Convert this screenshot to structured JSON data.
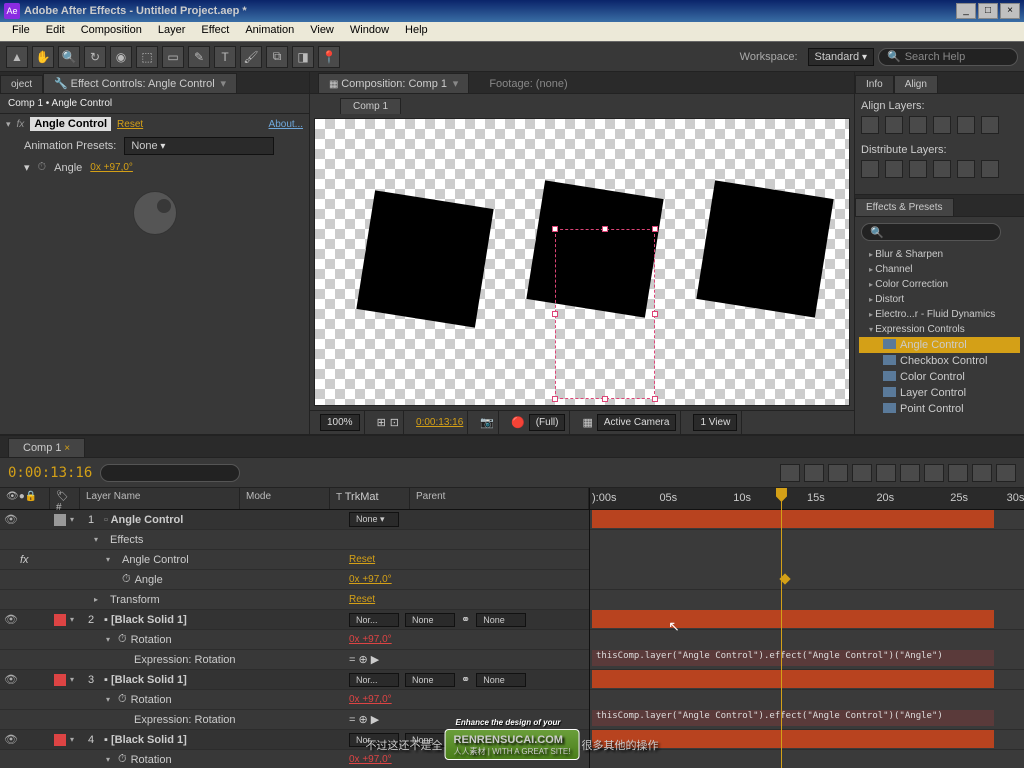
{
  "window": {
    "app_icon": "Ae",
    "title": "Adobe After Effects - Untitled Project.aep *"
  },
  "menu": [
    "File",
    "Edit",
    "Composition",
    "Layer",
    "Effect",
    "Animation",
    "View",
    "Window",
    "Help"
  ],
  "toolbar": {
    "workspace_label": "Workspace:",
    "workspace_value": "Standard",
    "search_placeholder": "Search Help"
  },
  "effect_controls": {
    "tab_project": "oject",
    "tab_effect": "Effect Controls: Angle Control",
    "breadcrumb": "Comp 1 • Angle Control",
    "effect_name": "Angle Control",
    "reset": "Reset",
    "about": "About...",
    "presets_label": "Animation Presets:",
    "presets_value": "None",
    "angle_label": "Angle",
    "angle_value": "0x +97,0°"
  },
  "composition": {
    "tab_label": "Composition: Comp 1",
    "footage_label": "Footage: (none)",
    "subtab": "Comp 1",
    "zoom": "100%",
    "timecode": "0:00:13:16",
    "quality": "(Full)",
    "camera": "Active Camera",
    "views": "1 View"
  },
  "right": {
    "tab_info": "Info",
    "tab_align": "Align",
    "align_label": "Align Layers:",
    "distribute_label": "Distribute Layers:",
    "ep_title": "Effects & Presets",
    "ep_items": [
      "Blur & Sharpen",
      "Channel",
      "Color Correction",
      "Distort",
      "Electro...r - Fluid Dynamics"
    ],
    "ep_open": "Expression Controls",
    "ep_subs": [
      "Angle Control",
      "Checkbox Control",
      "Color Control",
      "Layer Control",
      "Point Control"
    ]
  },
  "timeline": {
    "tab": "Comp 1",
    "time": "0:00:13:16",
    "cols": {
      "layer": "Layer Name",
      "mode": "Mode",
      "trkmat": "TrkMat",
      "parent": "Parent"
    },
    "ticks": [
      "):00s",
      "05s",
      "10s",
      "15s",
      "20s",
      "25s",
      "30s"
    ],
    "layers": {
      "l1_name": "Angle Control",
      "effects": "Effects",
      "angle_ctrl": "Angle Control",
      "angle_prop": "Angle",
      "angle_val": "0x +97,0°",
      "transform": "Transform",
      "reset": "Reset",
      "l2_name": "[Black Solid 1]",
      "l3_name": "[Black Solid 1]",
      "l4_name": "[Black Solid 1]",
      "rotation": "Rotation",
      "rot_val": "0x +97,0°",
      "expr_label": "Expression: Rotation",
      "mode_normal": "Nor...",
      "none": "None",
      "expr_text": "thisComp.layer(\"Angle Control\").effect(\"Angle Control\")(\"Angle\")"
    }
  },
  "subtitle": {
    "text_before": "不过这还不是全",
    "text_after": "很多其他的操作",
    "watermark": "RENRENSUCAI.COM",
    "tagline": "Enhance the design of your",
    "slogan": "人人素材 | WITH A GREAT SITE!"
  }
}
